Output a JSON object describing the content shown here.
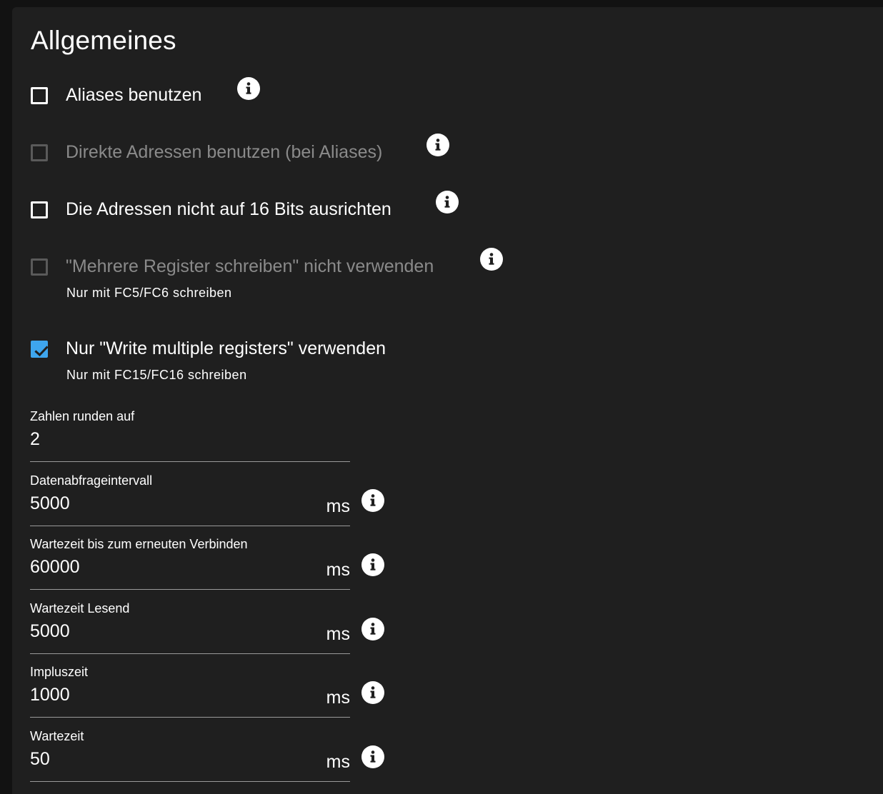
{
  "section": {
    "title": "Allgemeines"
  },
  "checkboxes": [
    {
      "label": "Aliases benutzen",
      "checked": false,
      "disabled": false,
      "helper": ""
    },
    {
      "label": "Direkte Adressen benutzen (bei Aliases)",
      "checked": false,
      "disabled": true,
      "helper": ""
    },
    {
      "label": "Die Adressen nicht auf 16 Bits ausrichten",
      "checked": false,
      "disabled": false,
      "helper": ""
    },
    {
      "label": "\"Mehrere Register schreiben\" nicht verwenden",
      "checked": false,
      "disabled": true,
      "helper": "Nur mit FC5/FC6 schreiben"
    },
    {
      "label": "Nur \"Write multiple registers\" verwenden",
      "checked": true,
      "disabled": false,
      "helper": "Nur mit FC15/FC16 schreiben"
    }
  ],
  "fields": [
    {
      "label": "Zahlen runden auf",
      "value": "2",
      "unit": ""
    },
    {
      "label": "Datenabfrageintervall",
      "value": "5000",
      "unit": "ms"
    },
    {
      "label": "Wartezeit bis zum erneuten Verbinden",
      "value": "60000",
      "unit": "ms"
    },
    {
      "label": "Wartezeit Lesend",
      "value": "5000",
      "unit": "ms"
    },
    {
      "label": "Impluszeit",
      "value": "1000",
      "unit": "ms"
    },
    {
      "label": "Wartezeit",
      "value": "50",
      "unit": "ms"
    }
  ],
  "colors": {
    "background": "#121212",
    "panel": "#1f1f1f",
    "accent": "#3ea6ee",
    "disabled_text": "#8a8a8a"
  },
  "icons": {
    "info": "info-icon",
    "check": "check-icon"
  }
}
